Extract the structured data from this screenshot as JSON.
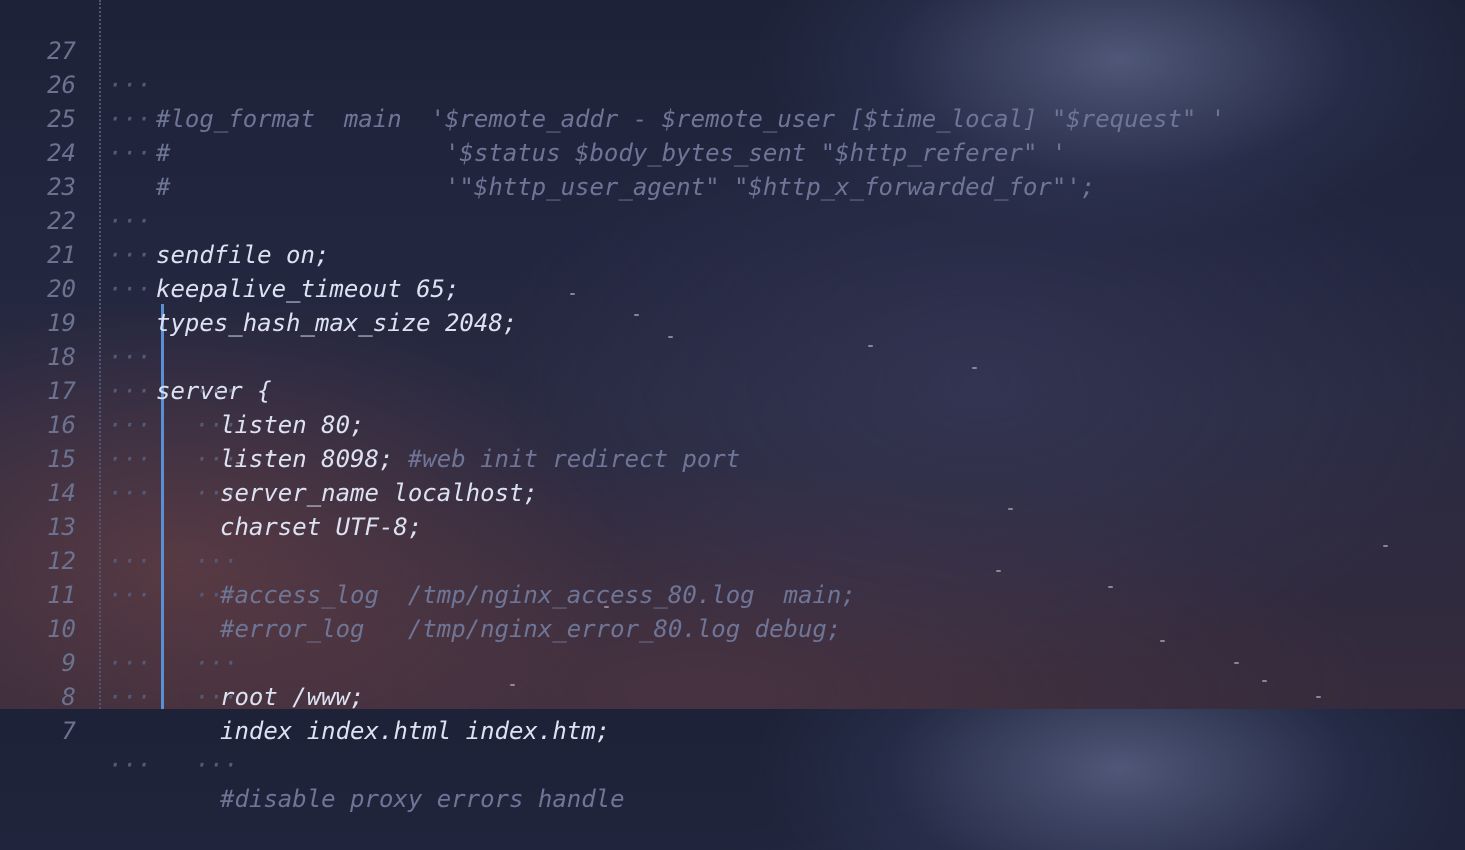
{
  "editor": {
    "lines": [
      {
        "number": "27",
        "guides": "···",
        "text": "#log_format  main  '$remote_addr - $remote_user [$time_local] \"$request\" '"
      },
      {
        "number": "26",
        "guides": "···",
        "text": "#                   '$status $body_bytes_sent \"$http_referer\" '"
      },
      {
        "number": "25",
        "guides": "···",
        "text": "#                   '\"$http_user_agent\" \"$http_x_forwarded_for\"';"
      },
      {
        "number": "24",
        "guides": "",
        "text": ""
      },
      {
        "number": "23",
        "guides": "···",
        "text": "sendfile on;"
      },
      {
        "number": "22",
        "guides": "···",
        "text": "keepalive_timeout 65;"
      },
      {
        "number": "21",
        "guides": "···",
        "text": "types_hash_max_size 2048;"
      },
      {
        "number": "20",
        "guides": "",
        "text": ""
      },
      {
        "number": "19",
        "guides": "···",
        "text": "server {"
      },
      {
        "number": "18",
        "guides": "···   ···",
        "text": "listen 80;"
      },
      {
        "number": "17",
        "guides": "···   ···",
        "text": "listen 8098; ",
        "comment": "#web init redirect port"
      },
      {
        "number": "16",
        "guides": "···   ···",
        "text": "server_name localhost;"
      },
      {
        "number": "15",
        "guides": "···   ···",
        "text": "charset UTF-8;"
      },
      {
        "number": "14",
        "guides": "",
        "text": ""
      },
      {
        "number": "13",
        "guides": "···   ···",
        "text": "#access_log  /tmp/nginx_access_80.log  main;"
      },
      {
        "number": "12",
        "guides": "···   ···",
        "text": "#error_log   /tmp/nginx_error_80.log debug;"
      },
      {
        "number": "11",
        "guides": "",
        "text": ""
      },
      {
        "number": "10",
        "guides": "···   ···",
        "text": "root /www;"
      },
      {
        "number": "9",
        "guides": "···   ···",
        "text": "index index.html index.htm;"
      },
      {
        "number": "8",
        "guides": "",
        "text": ""
      },
      {
        "number": "7",
        "guides": "···   ···",
        "text": "#disable proxy errors handle"
      }
    ]
  },
  "colors": {
    "text": "#dde2f2",
    "comment": "#6f7596",
    "line_number": "#6c7290",
    "scope_bar": "#5a8fd6"
  }
}
